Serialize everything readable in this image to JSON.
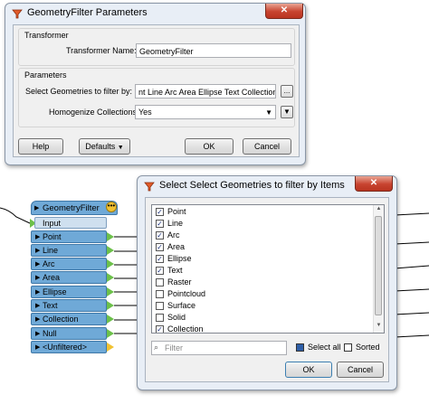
{
  "params_dialog": {
    "title": "GeometryFilter Parameters",
    "close_label": "✕",
    "transformer_group": {
      "title": "Transformer",
      "name_label": "Transformer Name:",
      "name_value": "GeometryFilter"
    },
    "parameters_group": {
      "title": "Parameters",
      "select_label": "Select Geometries to filter by:",
      "select_value": "nt Line Arc Area Ellipse Text Collection Null",
      "select_browse": "...",
      "homogenize_label": "Homogenize Collections:",
      "homogenize_value": "Yes",
      "homogenize_menu": "▼"
    },
    "help_label": "Help",
    "defaults_label": "Defaults",
    "ok_label": "OK",
    "cancel_label": "Cancel"
  },
  "transformer_node": {
    "name": "GeometryFilter",
    "menu_glyph": "•••",
    "input_label": "Input",
    "output_ports": [
      "Point",
      "Line",
      "Arc",
      "Area",
      "Ellipse",
      "Text",
      "Collection",
      "Null",
      "<Unfiltered>"
    ]
  },
  "select_dialog": {
    "title": "Select Select Geometries to filter by Items",
    "close_label": "✕",
    "items": [
      {
        "label": "Point",
        "checked": true
      },
      {
        "label": "Line",
        "checked": true
      },
      {
        "label": "Arc",
        "checked": true
      },
      {
        "label": "Area",
        "checked": true
      },
      {
        "label": "Ellipse",
        "checked": true
      },
      {
        "label": "Text",
        "checked": true
      },
      {
        "label": "Raster",
        "checked": false
      },
      {
        "label": "Pointcloud",
        "checked": false
      },
      {
        "label": "Surface",
        "checked": false
      },
      {
        "label": "Solid",
        "checked": false
      },
      {
        "label": "Collection",
        "checked": true
      }
    ],
    "filter_placeholder": "Filter",
    "select_all_label": "Select all",
    "select_all_checked": true,
    "sorted_label": "Sorted",
    "sorted_checked": false,
    "ok_label": "OK",
    "cancel_label": "Cancel"
  },
  "colors": {
    "port_blue": "#6fa9d7",
    "pin_green": "#6cc04a",
    "pin_yellow": "#f1c232",
    "close_red": "#c8432f"
  }
}
